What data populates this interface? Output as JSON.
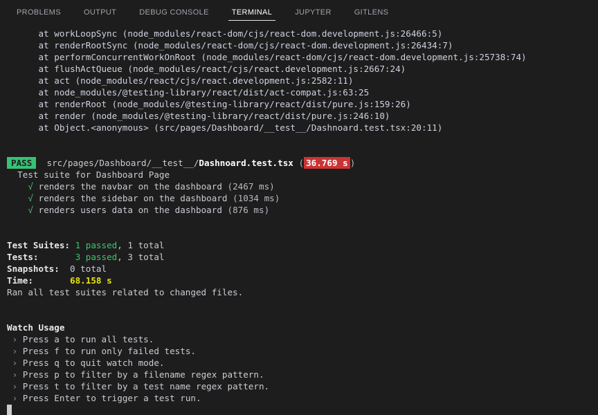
{
  "panel": {
    "tabs": [
      {
        "label": "PROBLEMS",
        "active": false
      },
      {
        "label": "OUTPUT",
        "active": false
      },
      {
        "label": "DEBUG CONSOLE",
        "active": false
      },
      {
        "label": "TERMINAL",
        "active": true
      },
      {
        "label": "JUPYTER",
        "active": false
      },
      {
        "label": "GITLENS",
        "active": false
      }
    ]
  },
  "terminal": {
    "stack_trace": [
      "      at workLoopSync (node_modules/react-dom/cjs/react-dom.development.js:26466:5)",
      "      at renderRootSync (node_modules/react-dom/cjs/react-dom.development.js:26434:7)",
      "      at performConcurrentWorkOnRoot (node_modules/react-dom/cjs/react-dom.development.js:25738:74)",
      "      at flushActQueue (node_modules/react/cjs/react.development.js:2667:24)",
      "      at act (node_modules/react/cjs/react.development.js:2582:11)",
      "      at node_modules/@testing-library/react/dist/act-compat.js:63:25",
      "      at renderRoot (node_modules/@testing-library/react/dist/pure.js:159:26)",
      "      at render (node_modules/@testing-library/react/dist/pure.js:246:10)",
      "      at Object.<anonymous> (src/pages/Dashboard/__test__/Dashnoard.test.tsx:20:11)"
    ],
    "result_header": {
      "status_badge": "PASS",
      "path_prefix": "src/pages/Dashboard/__test__/",
      "file_name": "Dashnoard.test.tsx",
      "duration_badge": "36.769 s",
      "paren_open": " (",
      "paren_close": ")"
    },
    "suite_title": "  Test suite for Dashboard Page",
    "tests": [
      {
        "mark": "√",
        "name": "renders the navbar on the dashboard",
        "duration": "(2467 ms)"
      },
      {
        "mark": "√",
        "name": "renders the sidebar on the dashboard",
        "duration": "(1034 ms)"
      },
      {
        "mark": "√",
        "name": "renders users data on the dashboard",
        "duration": "(876 ms)"
      }
    ],
    "summary": {
      "suites_label": "Test Suites:",
      "suites_passed": "1 passed",
      "suites_total": ", 1 total",
      "tests_label": "Tests:",
      "tests_passed": "3 passed",
      "tests_total": ", 3 total",
      "snapshots_label": "Snapshots:",
      "snapshots_value": "0 total",
      "time_label": "Time:",
      "time_value": "68.158 s",
      "ran_note": "Ran all test suites related to changed files."
    },
    "watch": {
      "title": "Watch Usage",
      "items": [
        "Press a to run all tests.",
        "Press f to run only failed tests.",
        "Press q to quit watch mode.",
        "Press p to filter by a filename regex pattern.",
        "Press t to filter by a test name regex pattern.",
        "Press Enter to trigger a test run."
      ],
      "chevron": "›"
    }
  },
  "colors": {
    "background": "#1d1d1d",
    "pass_badge": "#36c275",
    "time_badge": "#cc3333",
    "success_green": "#3ec46d",
    "warn_yellow": "#e5e510"
  }
}
